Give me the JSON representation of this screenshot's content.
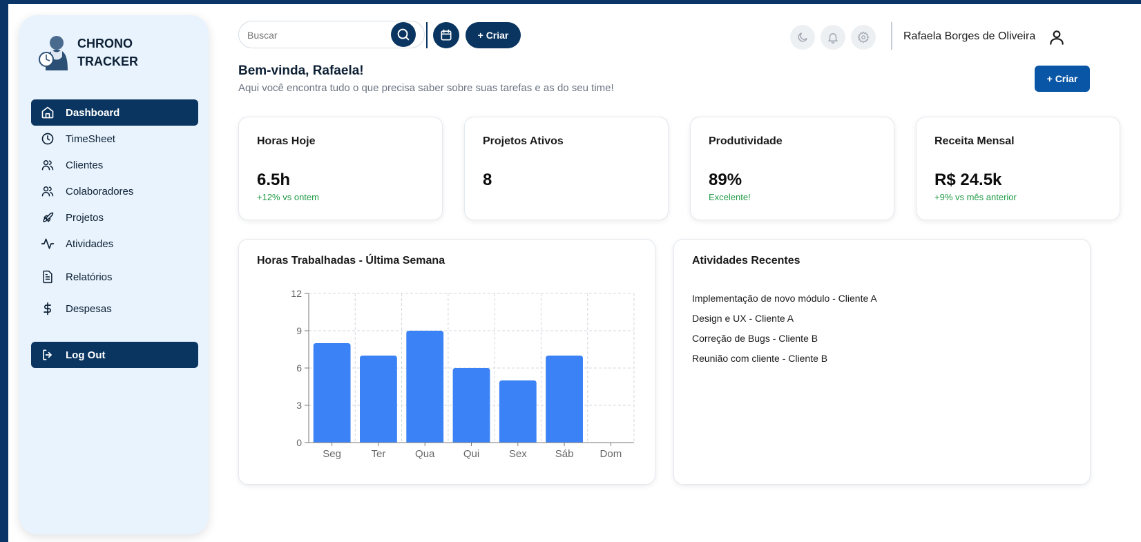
{
  "brand": {
    "line1": "CHRONO",
    "line2": "TRACKER"
  },
  "sidebar": {
    "items": [
      {
        "label": "Dashboard",
        "icon": "home-icon",
        "active": true
      },
      {
        "label": "TimeSheet",
        "icon": "clock-icon"
      },
      {
        "label": "Clientes",
        "icon": "users-icon"
      },
      {
        "label": "Colaboradores",
        "icon": "users-icon"
      },
      {
        "label": "Projetos",
        "icon": "rocket-icon"
      },
      {
        "label": "Atividades",
        "icon": "activity-icon"
      },
      {
        "label": "Relatórios",
        "icon": "file-text-icon"
      },
      {
        "label": "Despesas",
        "icon": "dollar-icon"
      }
    ],
    "logout": "Log Out"
  },
  "topbar": {
    "search_placeholder": "Buscar",
    "create_label": "+ Criar",
    "user_name": "Rafaela Borges de Oliveira"
  },
  "welcome": {
    "title": "Bem-vinda, Rafaela!",
    "subtitle": "Aqui você encontra tudo o que precisa saber sobre suas tarefas e as do seu time!",
    "create_label": "+ Criar"
  },
  "stats": [
    {
      "title": "Horas Hoje",
      "value": "6.5h",
      "sub": "+12% vs ontem"
    },
    {
      "title": "Projetos Ativos",
      "value": "8",
      "sub": ""
    },
    {
      "title": "Produtividade",
      "value": "89%",
      "sub": "Excelente!"
    },
    {
      "title": "Receita Mensal",
      "value": "R$ 24.5k",
      "sub": "+9% vs mês anterior"
    }
  ],
  "chart_title": "Horas Trabalhadas - Última Semana",
  "chart_data": {
    "type": "bar",
    "categories": [
      "Seg",
      "Ter",
      "Qua",
      "Qui",
      "Sex",
      "Sáb",
      "Dom"
    ],
    "values": [
      8,
      7,
      9,
      6,
      5,
      7,
      0
    ],
    "ylim": [
      0,
      12
    ],
    "yticks": [
      0,
      3,
      6,
      9,
      12
    ],
    "grid": true,
    "bar_color": "#3b82f6"
  },
  "activities": {
    "title": "Atividades Recentes",
    "items": [
      "Implementação de novo módulo - Cliente A",
      "Design e UX - Cliente A",
      "Correção de Bugs - Cliente B",
      "Reunião com cliente - Cliente B"
    ]
  },
  "colors": {
    "primary": "#0a3560",
    "accent": "#0a56a6",
    "positive": "#1f9a45",
    "sidebar_bg": "#e8f3fd",
    "frame": "#0b3566"
  }
}
